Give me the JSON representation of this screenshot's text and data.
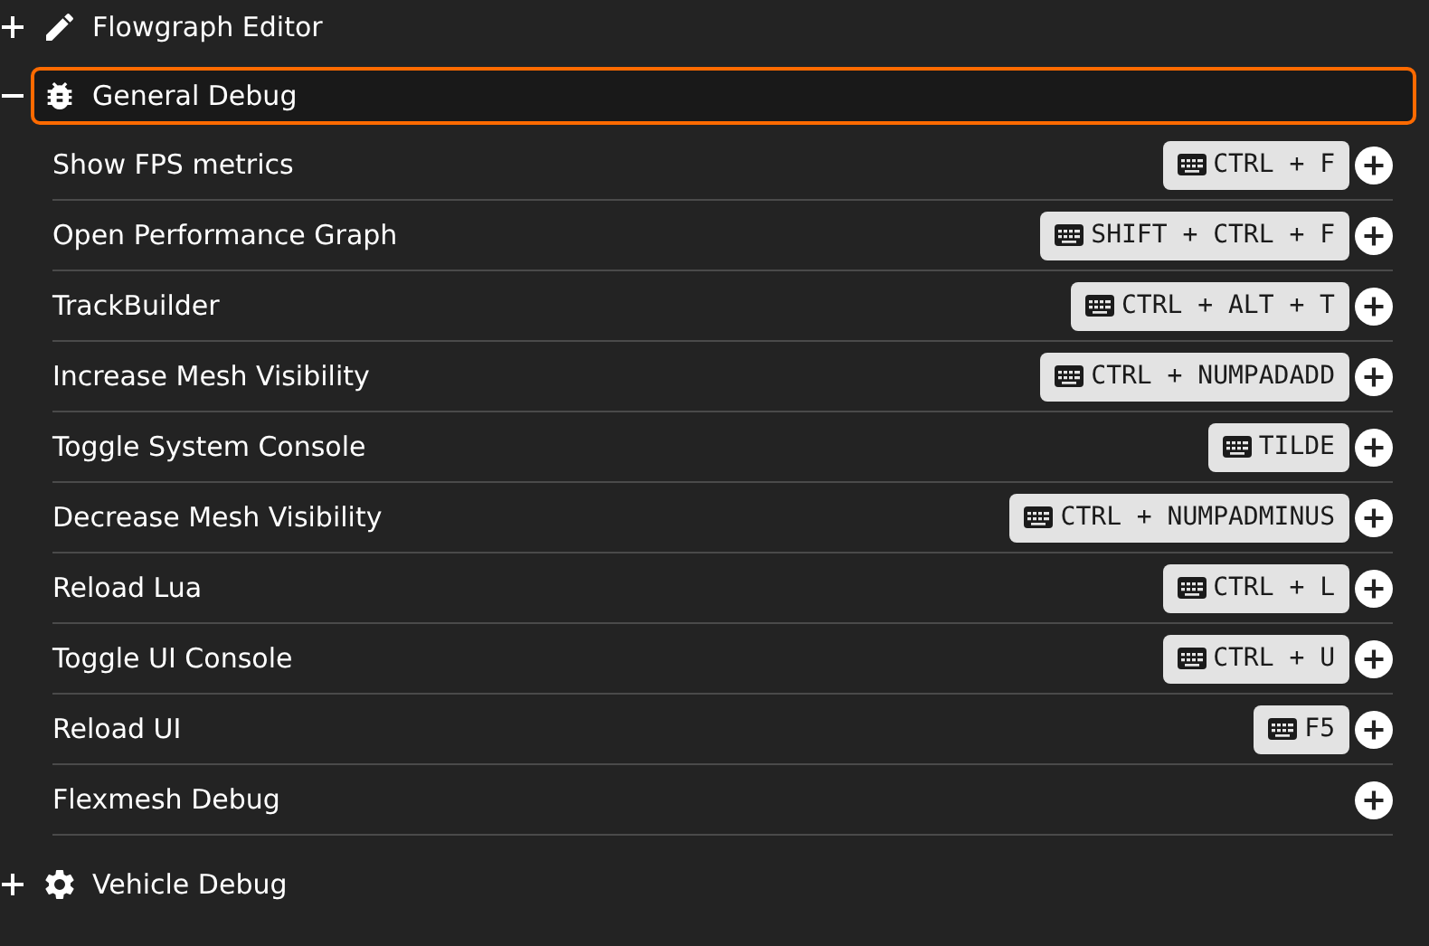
{
  "categories": [
    {
      "title": "Flowgraph Editor",
      "kind": "pencil",
      "expanded": false,
      "selected": false
    },
    {
      "title": "General Debug",
      "kind": "bug",
      "expanded": true,
      "selected": true,
      "actions": [
        {
          "label": "Show FPS metrics",
          "binding": "CTRL + F"
        },
        {
          "label": "Open Performance Graph",
          "binding": "SHIFT + CTRL + F"
        },
        {
          "label": "TrackBuilder",
          "binding": "CTRL + ALT + T"
        },
        {
          "label": "Increase Mesh Visibility",
          "binding": "CTRL + NUMPADADD"
        },
        {
          "label": "Toggle System Console",
          "binding": "TILDE"
        },
        {
          "label": "Decrease Mesh Visibility",
          "binding": "CTRL + NUMPADMINUS"
        },
        {
          "label": "Reload Lua",
          "binding": "CTRL + L"
        },
        {
          "label": "Toggle UI Console",
          "binding": "CTRL + U"
        },
        {
          "label": "Reload UI",
          "binding": "F5"
        },
        {
          "label": "Flexmesh Debug"
        }
      ]
    },
    {
      "title": "Vehicle Debug",
      "kind": "gear",
      "expanded": false,
      "selected": false
    }
  ]
}
